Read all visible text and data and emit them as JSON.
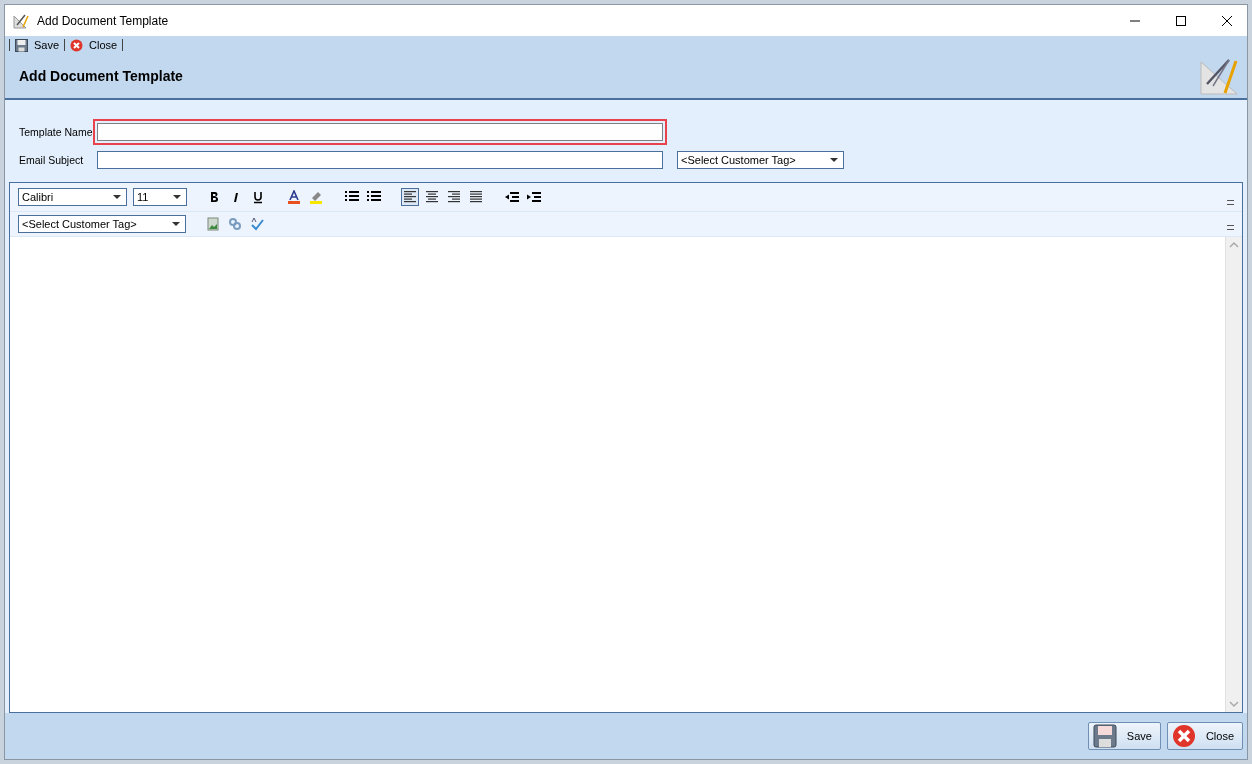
{
  "window": {
    "title": "Add Document Template"
  },
  "toolbar": [
    {
      "kind": "save",
      "label": "Save"
    },
    {
      "kind": "close",
      "label": "Close"
    }
  ],
  "header": {
    "title": "Add Document Template"
  },
  "form": {
    "fields": [
      {
        "label": "Template Name",
        "focused": true
      },
      {
        "label": "Email Subject",
        "focused": false
      }
    ],
    "subject_tag": {
      "value": "<Select Customer Tag>"
    }
  },
  "editor": {
    "font": {
      "value": "Calibri"
    },
    "size": {
      "value": "11"
    },
    "format_buttons": [
      {
        "kind": "bold",
        "selected": false
      },
      {
        "kind": "italic",
        "selected": false
      },
      {
        "kind": "underline",
        "selected": false
      },
      {
        "kind": "gap"
      },
      {
        "kind": "font-color",
        "selected": false
      },
      {
        "kind": "highlight",
        "selected": false
      },
      {
        "kind": "gap"
      },
      {
        "kind": "bullets",
        "selected": false
      },
      {
        "kind": "numbering",
        "selected": false
      },
      {
        "kind": "gap"
      },
      {
        "kind": "align-left",
        "selected": true
      },
      {
        "kind": "align-center",
        "selected": false
      },
      {
        "kind": "align-right",
        "selected": false
      },
      {
        "kind": "justify",
        "selected": false
      },
      {
        "kind": "gap"
      },
      {
        "kind": "outdent",
        "selected": false
      },
      {
        "kind": "indent",
        "selected": false
      }
    ],
    "tag": {
      "value": "<Select Customer Tag>"
    },
    "insert_buttons": [
      {
        "kind": "image"
      },
      {
        "kind": "link"
      },
      {
        "kind": "spellcheck"
      }
    ]
  },
  "footer": {
    "buttons": [
      {
        "kind": "save",
        "label": "Save"
      },
      {
        "kind": "close",
        "label": "Close"
      }
    ]
  }
}
